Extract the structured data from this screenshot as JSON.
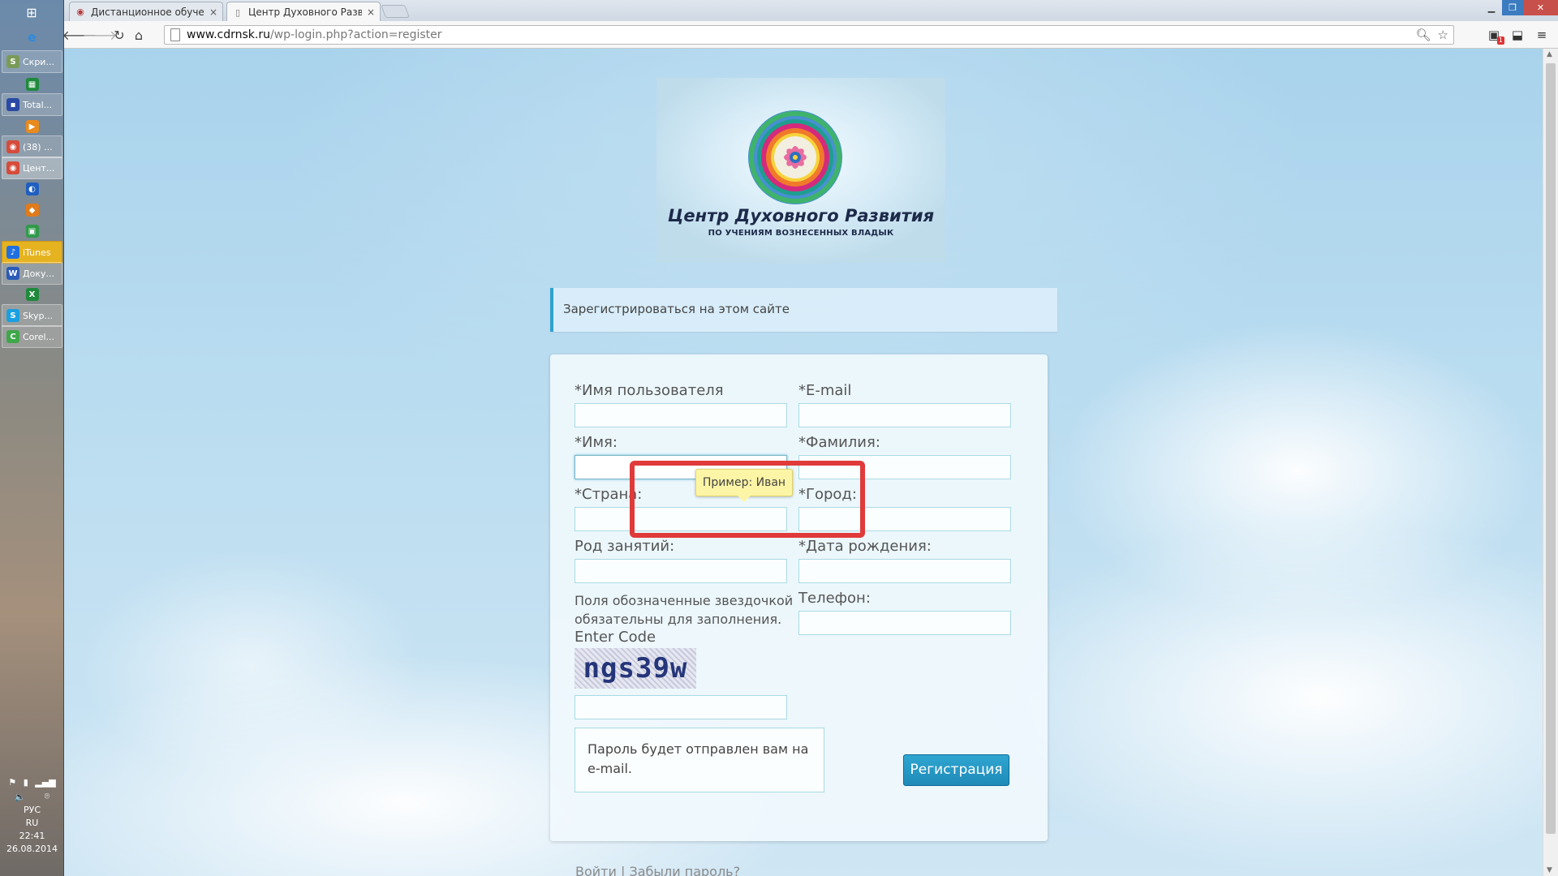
{
  "taskbar": {
    "items": [
      {
        "label": "Скри...",
        "icon": "app-icon",
        "color": "#7a9b58"
      },
      {
        "label": "",
        "icon": "spreadsheet-icon",
        "color": "#1f8a3c"
      },
      {
        "label": "Total...",
        "icon": "floppy-icon",
        "color": "#2a4aa5"
      },
      {
        "label": "",
        "icon": "media-player-icon",
        "color": "#e88a1e"
      },
      {
        "label": "(38) ...",
        "icon": "chrome-icon",
        "color": "#d64b3b"
      },
      {
        "label": "Цент...",
        "icon": "chrome-icon",
        "color": "#d64b3b"
      },
      {
        "label": "",
        "icon": "globe-icon",
        "color": "#1f5fbf"
      },
      {
        "label": "",
        "icon": "shield-icon",
        "color": "#e07a1a"
      },
      {
        "label": "",
        "icon": "app-green-icon",
        "color": "#2f9a4a"
      },
      {
        "label": "iTunes",
        "icon": "itunes-icon",
        "color": "#1f6fe0"
      },
      {
        "label": "Доку...",
        "icon": "word-icon",
        "color": "#2b5bb8"
      },
      {
        "label": "",
        "icon": "excel-icon",
        "color": "#1f8a3c"
      },
      {
        "label": "Skyp...",
        "icon": "skype-icon",
        "color": "#1aa0e0"
      },
      {
        "label": "Corel...",
        "icon": "corel-icon",
        "color": "#3fa84a"
      }
    ],
    "tray": {
      "lang_1": "РУС",
      "lang_2": "RU",
      "time": "22:41",
      "date": "26.08.2014"
    }
  },
  "browser": {
    "tabs": [
      {
        "title": "Дистанционное обучени",
        "close": "×"
      },
      {
        "title": "Центр Духовного Развит",
        "close": "×"
      }
    ],
    "url_host": "www.cdrnsk.ru",
    "url_path": "/wp-login.php?action=register",
    "ext_badge": "1"
  },
  "page": {
    "logo_title": "Центр Духовного Развития",
    "logo_subtitle": "ПО УЧЕНИЯМ ВОЗНЕСЕННЫХ ВЛАДЫК",
    "message": "Зарегистрироваться на этом сайте",
    "form": {
      "username_label": "*Имя пользователя",
      "email_label": "*E-mail",
      "first_name_label": "*Имя:",
      "last_name_label": "*Фамилия:",
      "country_label": "*Страна:",
      "city_label": "*Город:",
      "occupation_label": "Род занятий:",
      "birthdate_label": "*Дата рождения:",
      "phone_label": "Телефон:",
      "required_note": "Поля обозначенные звездочкой обязательны для заполнения.",
      "enter_code_label": "Enter Code",
      "captcha_text": "ngs39w",
      "password_note": "Пароль будет отправлен вам на e-mail.",
      "submit_label": "Регистрация"
    },
    "tooltip": "Пример: Иван",
    "login_link": "Войти",
    "separator": "|",
    "lost_password_link": "Забыли пароль?"
  }
}
